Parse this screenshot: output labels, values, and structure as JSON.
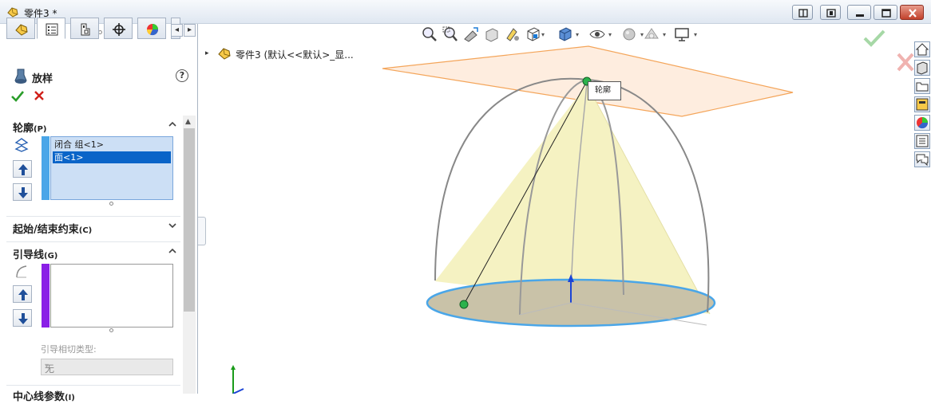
{
  "window": {
    "title": "零件3 *"
  },
  "panel": {
    "feature_title": "放样",
    "help": "?",
    "sections": {
      "profiles": {
        "title": "轮廓",
        "shortcut": "(P)",
        "items": [
          "闭合 组<1>",
          "面<1>"
        ],
        "selected_index": 1
      },
      "start_end": {
        "title": "起始/结束约束",
        "shortcut": "(C)"
      },
      "guides": {
        "title": "引导线",
        "shortcut": "(G)",
        "items": [],
        "tangency_label": "引导相切类型:",
        "tangency_value": "无"
      },
      "centerline": {
        "title": "中心线参数",
        "shortcut": "(I)"
      }
    },
    "tab_icons": [
      "feature-manager-icon",
      "property-manager-icon",
      "configuration-manager-icon",
      "dimxpert-icon",
      "display-manager-icon"
    ]
  },
  "tree": {
    "label": "零件3  (默认<<默认>_显..."
  },
  "callout": {
    "text": "轮廓"
  },
  "toolbar": [
    "zoom-to-fit-icon",
    "zoom-area-icon",
    "previous-view-icon",
    "section-view-icon",
    "dynamic-annotation-icon",
    "view-orientation-icon",
    "display-style-icon",
    "hide-show-items-icon",
    "edit-appearance-icon",
    "apply-scene-icon",
    "view-settings-icon"
  ],
  "colors": {
    "profile_accent": "#4aa6e8",
    "guide_accent": "#8a1fe6",
    "cone_fill": "#f5f2c2",
    "plane_fill": "#fde7d4",
    "plane_border": "#f4a55a",
    "selection_blue": "#0a64c8"
  }
}
